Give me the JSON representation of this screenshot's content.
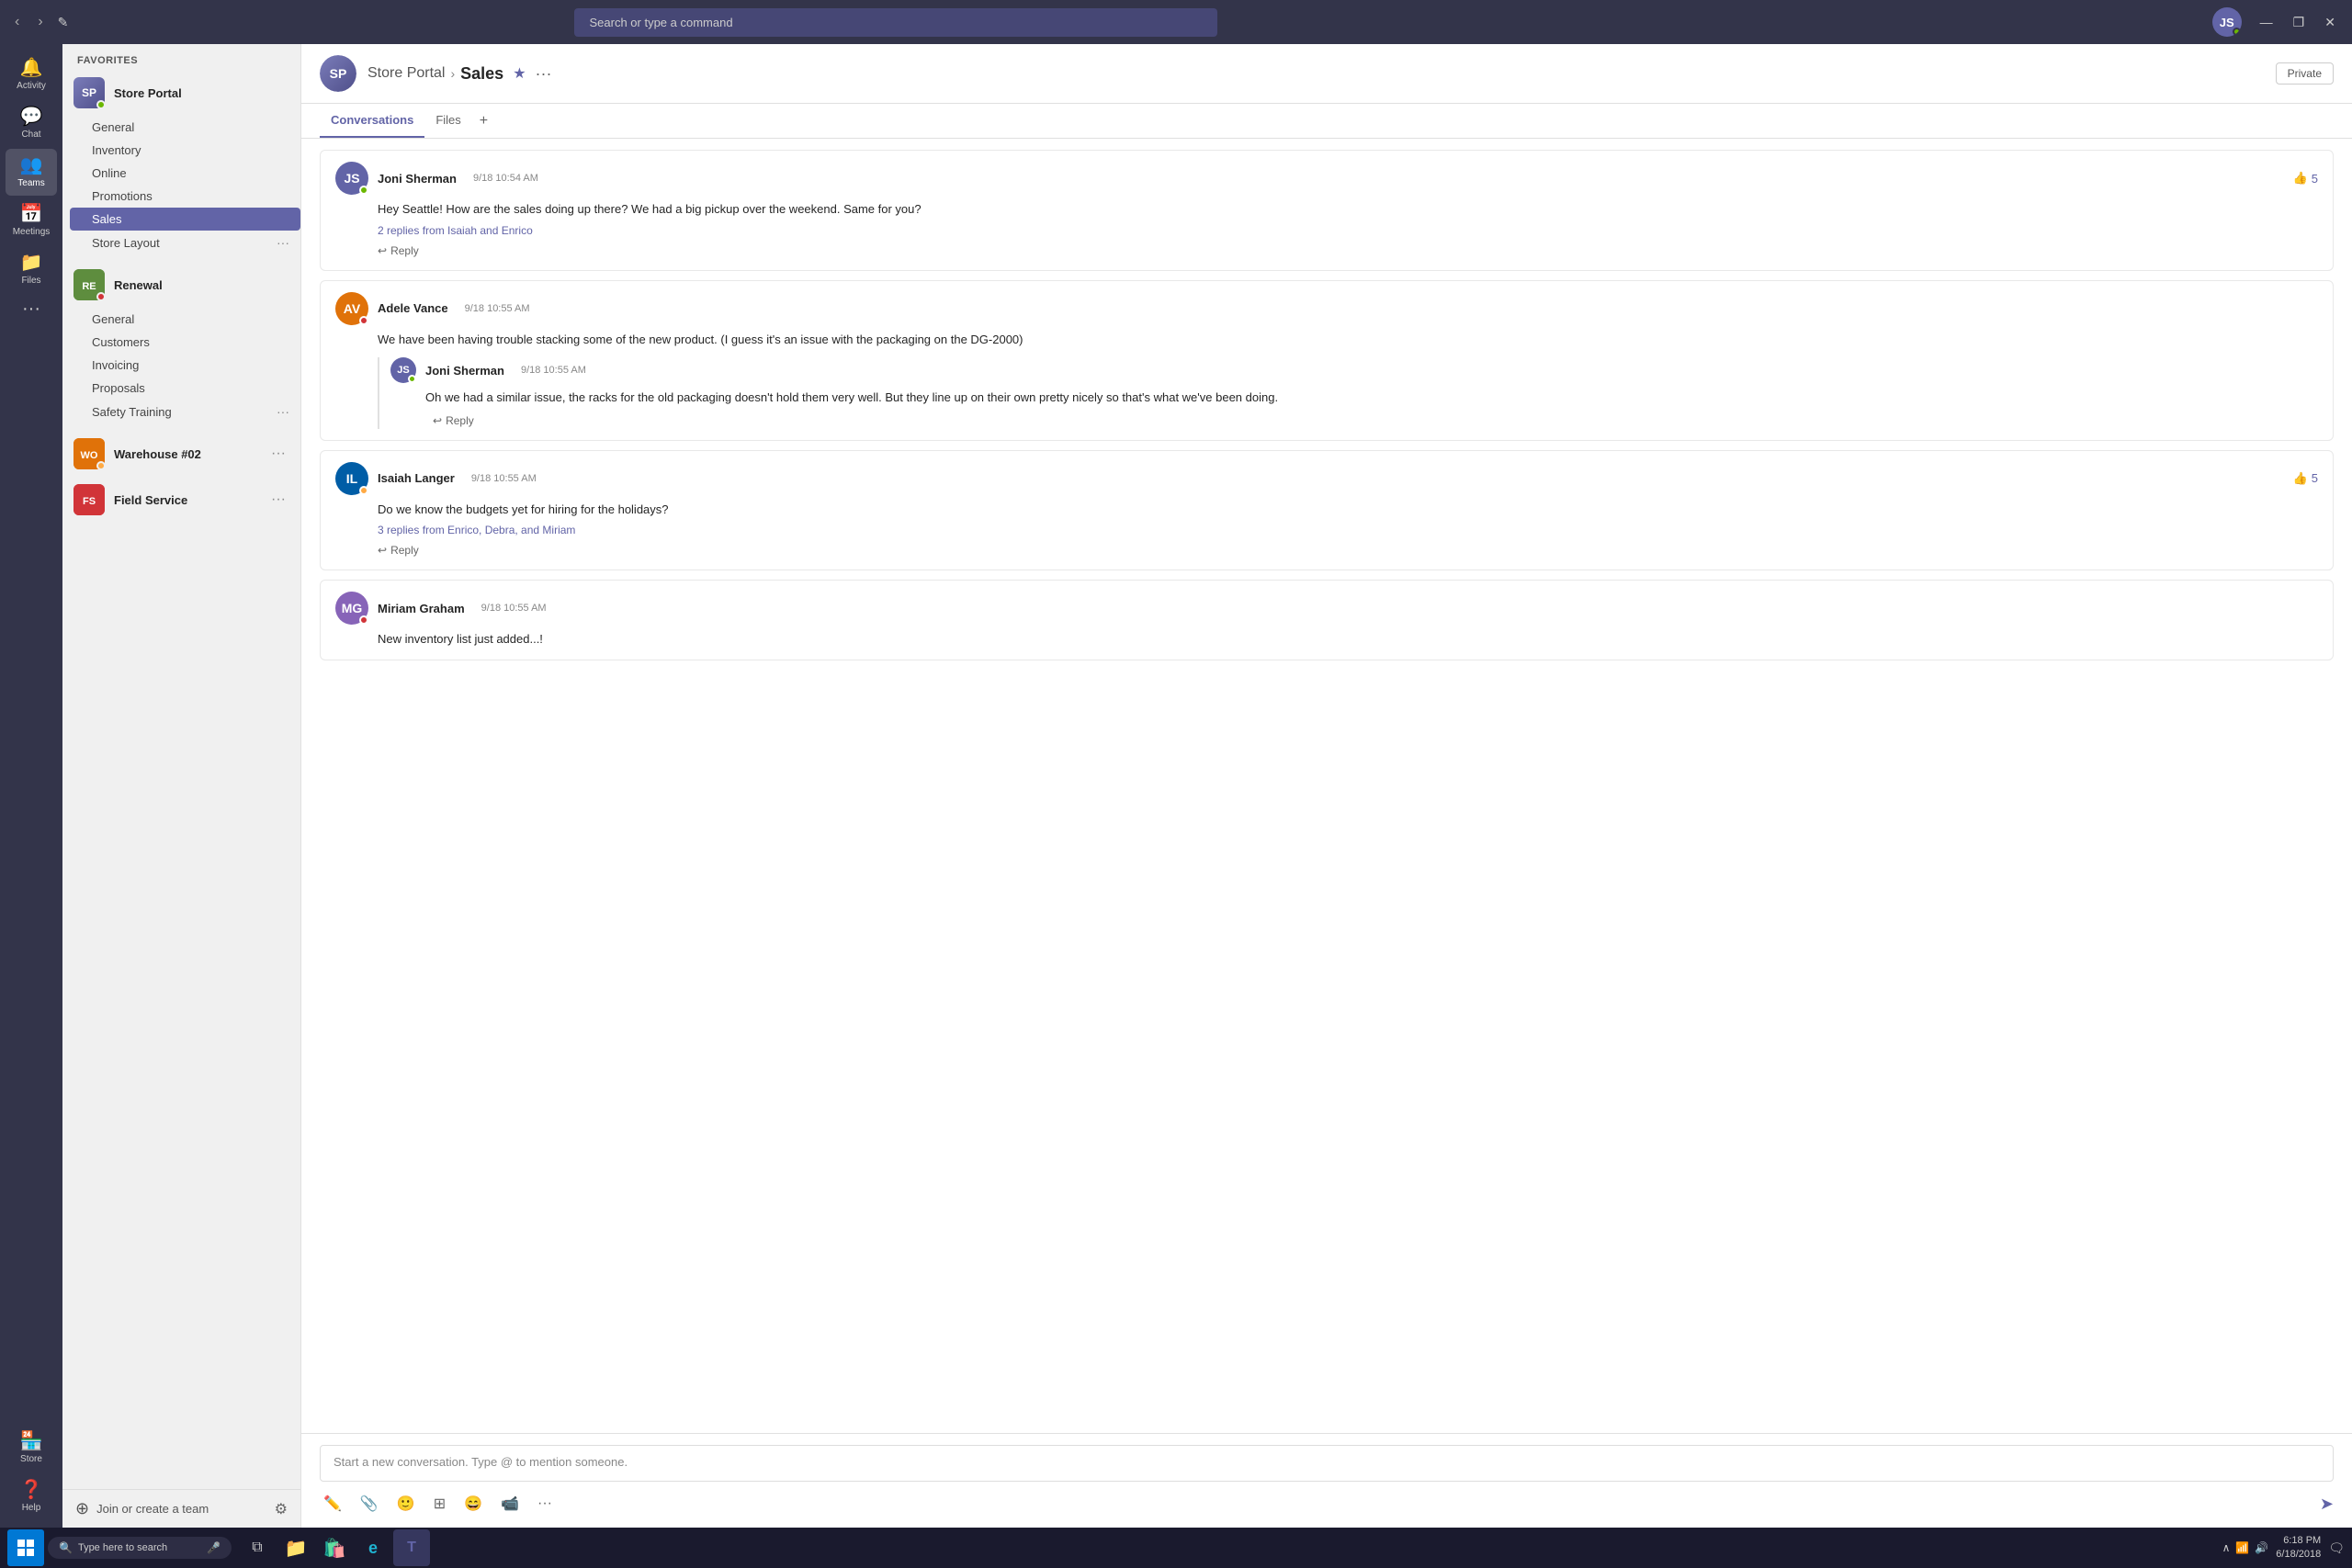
{
  "titlebar": {
    "search_placeholder": "Search or type a command",
    "nav_back": "‹",
    "nav_forward": "›",
    "compose": "✎",
    "min": "—",
    "max": "❐",
    "close": "✕"
  },
  "rail": {
    "items": [
      {
        "id": "activity",
        "label": "Activity",
        "icon": "🔔"
      },
      {
        "id": "chat",
        "label": "Chat",
        "icon": "💬"
      },
      {
        "id": "teams",
        "label": "Teams",
        "icon": "👥",
        "active": true
      },
      {
        "id": "meetings",
        "label": "Meetings",
        "icon": "📅"
      },
      {
        "id": "files",
        "label": "Files",
        "icon": "📁"
      },
      {
        "id": "store",
        "label": "Store",
        "icon": "🏪"
      },
      {
        "id": "help",
        "label": "Help",
        "icon": "❓"
      }
    ],
    "more": "···"
  },
  "sidebar": {
    "favorites_label": "Favorites",
    "teams": [
      {
        "id": "store-portal",
        "name": "Store Portal",
        "icon_color": "#6264a7",
        "icon_text": "SP",
        "has_avatar": true,
        "channels": [
          {
            "id": "general",
            "name": "General",
            "active": false,
            "has_more": false
          },
          {
            "id": "inventory",
            "name": "Inventory",
            "active": false,
            "has_more": false
          },
          {
            "id": "online",
            "name": "Online",
            "active": false,
            "has_more": false
          },
          {
            "id": "promotions",
            "name": "Promotions",
            "active": false,
            "has_more": false
          },
          {
            "id": "sales",
            "name": "Sales",
            "active": true,
            "has_more": false
          },
          {
            "id": "store-layout",
            "name": "Store Layout",
            "active": false,
            "has_more": true
          }
        ]
      },
      {
        "id": "renewal",
        "name": "Renewal",
        "icon_color": "#5e8d3e",
        "icon_text": "RE",
        "has_avatar": false,
        "channels": [
          {
            "id": "general2",
            "name": "General",
            "active": false,
            "has_more": false
          },
          {
            "id": "customers",
            "name": "Customers",
            "active": false,
            "has_more": false
          },
          {
            "id": "invoicing",
            "name": "Invoicing",
            "active": false,
            "has_more": false
          },
          {
            "id": "proposals",
            "name": "Proposals",
            "active": false,
            "has_more": false
          },
          {
            "id": "safety-training",
            "name": "Safety Training",
            "active": false,
            "has_more": true
          }
        ]
      },
      {
        "id": "warehouse",
        "name": "Warehouse #02",
        "icon_color": "#e07209",
        "icon_text": "WO",
        "has_avatar": false,
        "channels": []
      },
      {
        "id": "field-service",
        "name": "Field Service",
        "icon_color": "#d13438",
        "icon_text": "FS",
        "has_avatar": false,
        "channels": []
      }
    ],
    "join_label": "Join or create a team"
  },
  "channel_header": {
    "team_name": "Store Portal",
    "channel_name": "Sales",
    "separator": "›",
    "badge": "Private",
    "more_icon": "···"
  },
  "tabs": {
    "items": [
      {
        "id": "conversations",
        "label": "Conversations",
        "active": true
      },
      {
        "id": "files",
        "label": "Files",
        "active": false
      }
    ],
    "add_icon": "+"
  },
  "messages": [
    {
      "id": "msg1",
      "author": "Joni Sherman",
      "time": "9/18 10:54 AM",
      "avatar_color": "#6264a7",
      "avatar_initials": "JS",
      "status": "online",
      "body": "Hey Seattle! How are the sales doing up there? We had a big pickup over the weekend. Same for you?",
      "likes": 5,
      "replies_text": "2 replies from Isaiah and Enrico",
      "reply_label": "Reply",
      "nested_replies": []
    },
    {
      "id": "msg2",
      "author": "Adele Vance",
      "time": "9/18 10:55 AM",
      "avatar_color": "#e07209",
      "avatar_initials": "AV",
      "status": "busy",
      "body": "We have been having trouble stacking some of the new product. (I guess it's an issue with the packaging on the DG-2000)",
      "likes": 0,
      "replies_text": "",
      "reply_label": "Reply",
      "nested_replies": [
        {
          "id": "reply1",
          "author": "Joni Sherman",
          "time": "9/18 10:55 AM",
          "avatar_color": "#6264a7",
          "avatar_initials": "JS",
          "status": "online",
          "body": "Oh we had a similar issue, the racks for the old packaging doesn't hold them very well. But they line up on their own pretty nicely so that's what we've been doing.",
          "reply_label": "Reply"
        }
      ]
    },
    {
      "id": "msg3",
      "author": "Isaiah Langer",
      "time": "9/18 10:55 AM",
      "avatar_color": "#005da6",
      "avatar_initials": "IL",
      "status": "away",
      "body": "Do we know the budgets yet for hiring for the holidays?",
      "likes": 5,
      "replies_text": "3 replies from Enrico, Debra, and Miriam",
      "reply_label": "Reply",
      "nested_replies": []
    },
    {
      "id": "msg4",
      "author": "Miriam Graham",
      "time": "9/18 10:55 AM",
      "avatar_color": "#8764b8",
      "avatar_initials": "MG",
      "status": "busy",
      "body": "New inventory list just added...!",
      "likes": 0,
      "replies_text": "",
      "reply_label": "Reply",
      "nested_replies": []
    }
  ],
  "compose": {
    "placeholder": "Start a new conversation. Type @ to mention someone.",
    "tools": [
      "✏️",
      "📎",
      "😊",
      "⊞",
      "😄",
      "📹",
      "···"
    ],
    "send_icon": "➤"
  },
  "taskbar": {
    "search_placeholder": "Type here to search",
    "mic_icon": "🎤",
    "time": "6:18 PM",
    "date": "6/18/2018",
    "apps": [
      {
        "id": "taskview",
        "icon": "⧉"
      },
      {
        "id": "explorer",
        "icon": "📁"
      },
      {
        "id": "store",
        "icon": "🛍️"
      },
      {
        "id": "edge",
        "icon": "e"
      },
      {
        "id": "teams",
        "icon": "T"
      }
    ]
  }
}
